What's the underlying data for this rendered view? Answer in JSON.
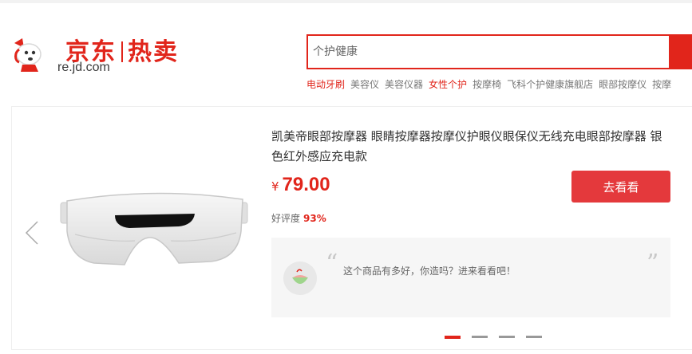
{
  "logo": {
    "brand_left": "京东",
    "brand_right": "热卖",
    "domain": "re.jd.com"
  },
  "search": {
    "placeholder": "个护健康"
  },
  "hotwords": [
    {
      "label": "电动牙刷",
      "red": true
    },
    {
      "label": "美容仪",
      "red": false
    },
    {
      "label": "美容仪器",
      "red": false
    },
    {
      "label": "女性个护",
      "red": true
    },
    {
      "label": "按摩椅",
      "red": false
    },
    {
      "label": "飞科个护健康旗舰店",
      "red": false
    },
    {
      "label": "眼部按摩仪",
      "red": false
    },
    {
      "label": "按摩",
      "red": false
    }
  ],
  "product": {
    "title": "凯美帝眼部按摩器 眼睛按摩器按摩仪护眼仪眼保仪无线充电眼部按摩器 银色红外感应充电款",
    "currency": "¥",
    "price": "79.00",
    "button_label": "去看看",
    "rating_label": "好评度",
    "rating_value": "93%"
  },
  "comment": {
    "text": "这个商品有多好，你造吗？进来看看吧！"
  },
  "carousel": {
    "count": 4,
    "active_index": 0
  },
  "colors": {
    "brand_red": "#e1251b",
    "button_red": "#e4393c"
  }
}
